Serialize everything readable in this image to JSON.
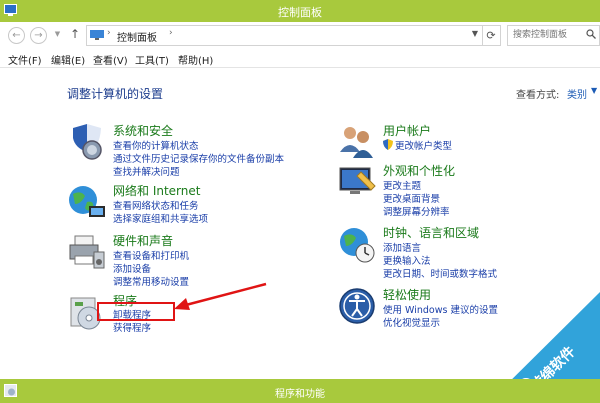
{
  "window": {
    "title": "控制面板"
  },
  "address": {
    "crumb": "控制面板",
    "search_placeholder": "搜索控制面板"
  },
  "menu": [
    "文件(F)",
    "编辑(E)",
    "查看(V)",
    "工具(T)",
    "帮助(H)"
  ],
  "content": {
    "heading": "调整计算机的设置",
    "view_by_label": "查看方式:",
    "view_by_value": "类别"
  },
  "categories": {
    "system": {
      "title": "系统和安全",
      "links": [
        "查看你的计算机状态",
        "通过文件历史记录保存你的文件备份副本",
        "查找并解决问题"
      ]
    },
    "network": {
      "title": "网络和 Internet",
      "links": [
        "查看网络状态和任务",
        "选择家庭组和共享选项"
      ]
    },
    "hardware": {
      "title": "硬件和声音",
      "links": [
        "查看设备和打印机",
        "添加设备",
        "调整常用移动设置"
      ]
    },
    "programs": {
      "title": "程序",
      "links": [
        "卸载程序",
        "获得程序"
      ]
    },
    "user": {
      "title": "用户帐户",
      "links": [
        "更改帐户类型"
      ]
    },
    "appearance": {
      "title": "外观和个性化",
      "links": [
        "更改主题",
        "更改桌面背景",
        "调整屏幕分辨率"
      ]
    },
    "clock": {
      "title": "时钟、语言和区域",
      "links": [
        "添加语言",
        "更换输入法",
        "更改日期、时间或数字格式"
      ]
    },
    "ease": {
      "title": "轻松使用",
      "links": [
        "使用 Windows 建议的设置",
        "优化视觉显示"
      ]
    }
  },
  "watermark": {
    "text": "游绵软件"
  },
  "taskbar": {
    "title": "程序和功能"
  },
  "colors": {
    "accent": "#a8c93d",
    "link": "#1a3ea8",
    "category_title": "#1a7a1a",
    "heading": "#1b3b8c",
    "highlight": "#e01414"
  }
}
